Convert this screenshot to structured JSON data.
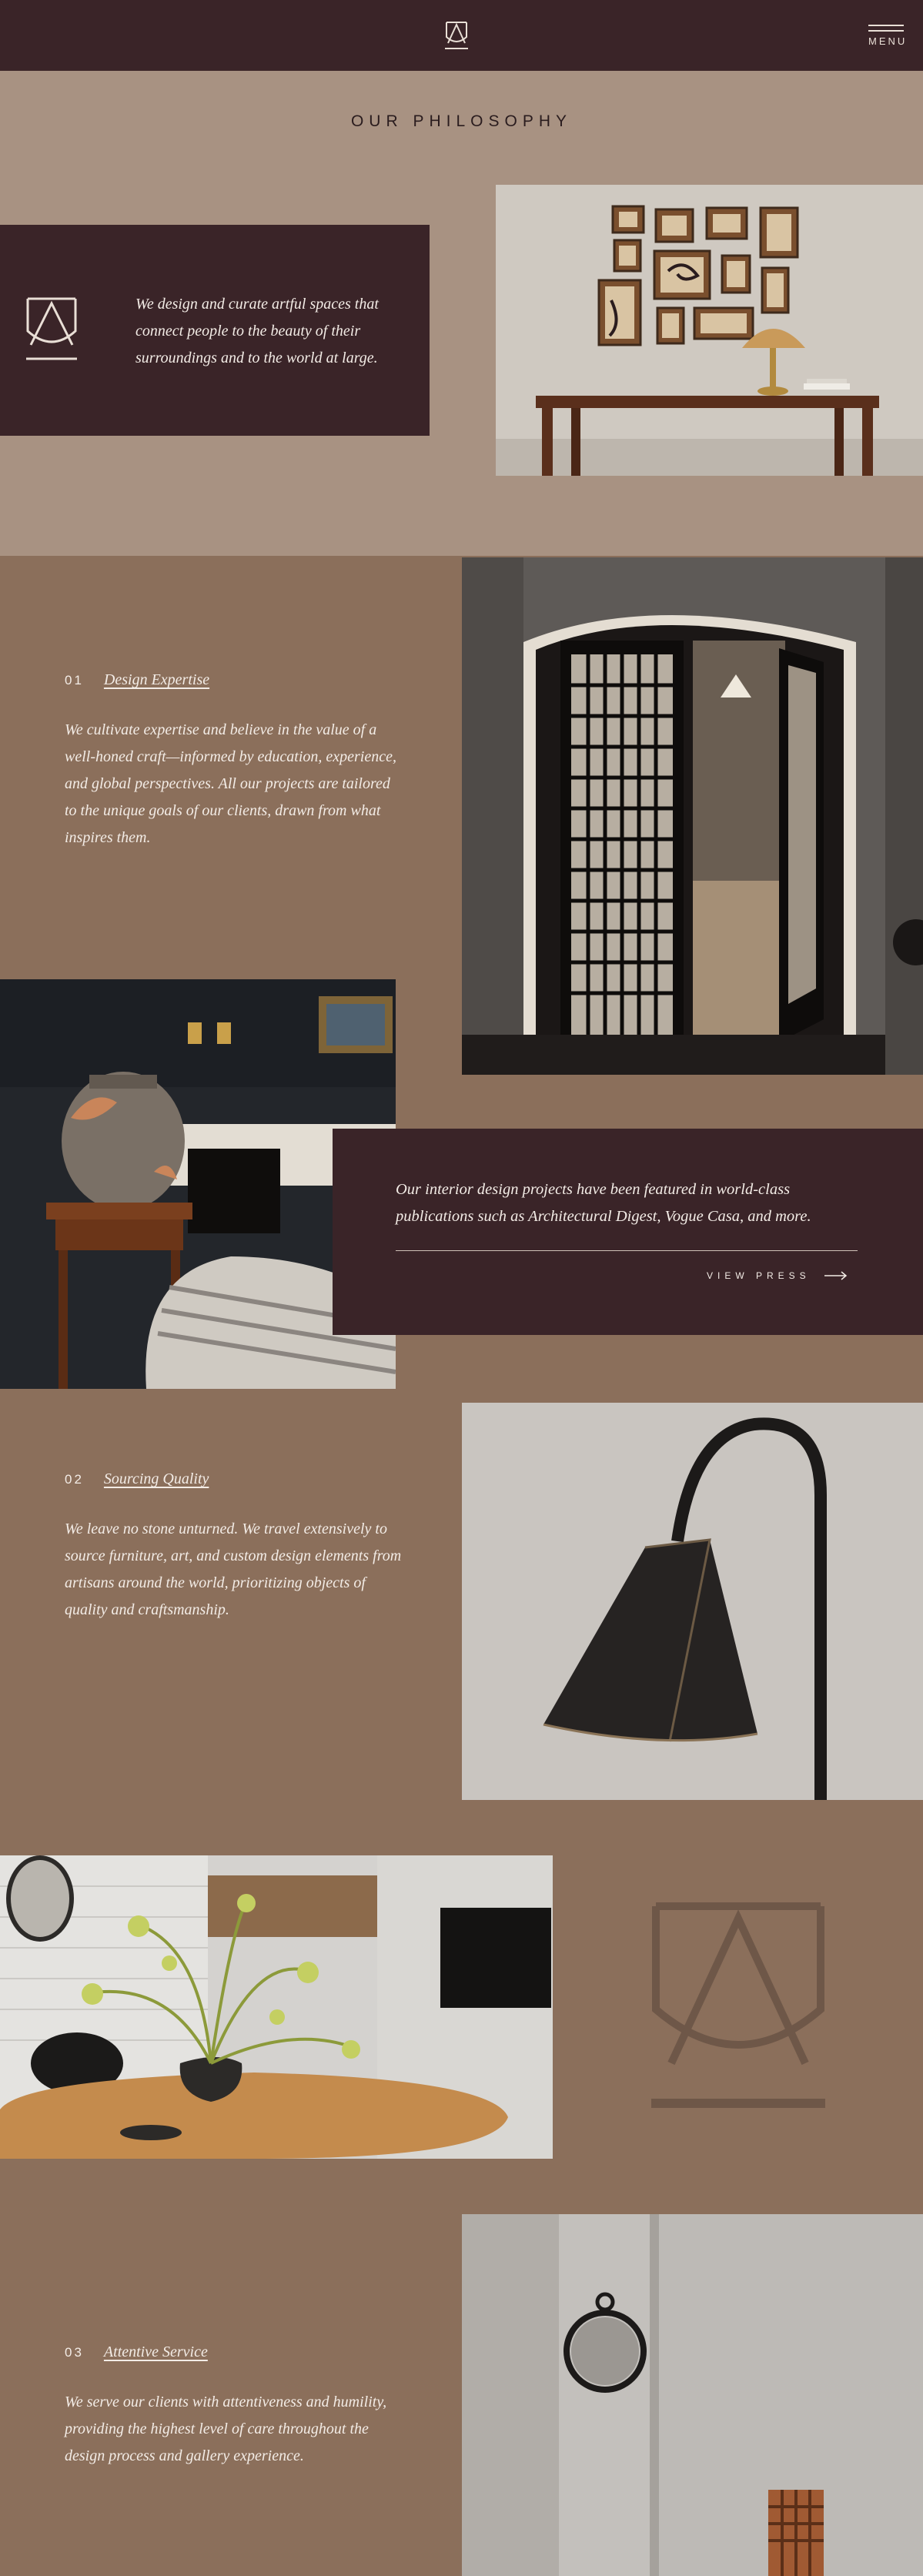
{
  "header": {
    "menu_label": "MENU"
  },
  "philosophy": {
    "title": "OUR PHILOSOPHY",
    "intro": "We design and curate artful spaces that connect people to the beauty of their surroundings and to the world at large."
  },
  "sections": [
    {
      "number": "01",
      "title": "Design Expertise",
      "body": "We cultivate expertise and believe in the value of a well-honed craft—informed by education, experience, and global perspectives. All our projects are tailored to the unique goals of our clients, drawn from what inspires them."
    },
    {
      "number": "02",
      "title": "Sourcing Quality",
      "body": "We leave no stone unturned. We travel extensively to source furniture, art, and custom design elements from artisans around the world, prioritizing objects of quality and craftsmanship."
    },
    {
      "number": "03",
      "title": "Attentive Service",
      "body": "We serve our clients with attentiveness and humility, providing the highest level of care throughout the design process and gallery experience."
    }
  ],
  "press": {
    "text": "Our interior design projects have been featured in world-class publications such as Architectural Digest, Vogue Casa, and more.",
    "link_label": "VIEW PRESS"
  },
  "colors": {
    "header_bg": "#3a2428",
    "band_light": "#a89282",
    "band_brown": "#8b6f5b",
    "text_light": "#f3ece6"
  }
}
